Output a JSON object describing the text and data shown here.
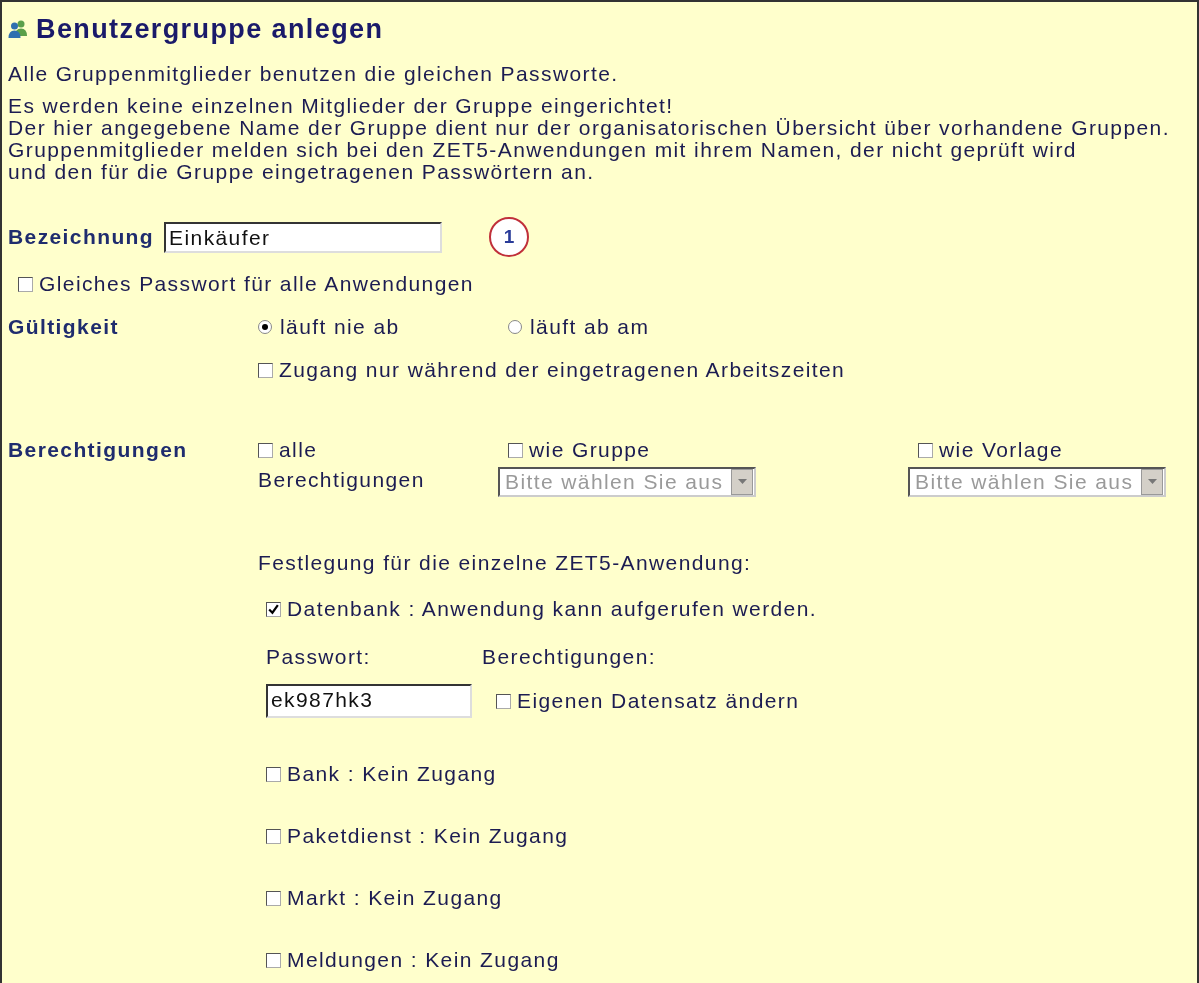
{
  "header": {
    "title": "Benutzergruppe anlegen"
  },
  "intro": "Alle Gruppenmitglieder benutzen die gleichen Passworte.",
  "notes": [
    "Es werden keine einzelnen Mitglieder der Gruppe eingerichtet!",
    "Der hier angegebene Name der Gruppe dient nur der organisatorischen Übersicht über vorhandene Gruppen.",
    "Gruppenmitglieder melden sich bei den ZET5-Anwendungen mit ihrem Namen, der nicht geprüft wird",
    "und den für die Gruppe eingetragenen Passwörtern an."
  ],
  "name_field": {
    "label": "Bezeichnung",
    "value": "Einkäufer",
    "callout": "1"
  },
  "same_password": {
    "label": "Gleiches Passwort für alle Anwendungen",
    "checked": false
  },
  "validity": {
    "label": "Gültigkeit",
    "options": [
      {
        "label": "läuft nie ab",
        "selected": true
      },
      {
        "label": "läuft ab am",
        "selected": false
      }
    ],
    "working_hours": {
      "label": "Zugang nur während der eingetragenen Arbeitszeiten",
      "checked": false
    }
  },
  "permissions": {
    "label": "Berechtigungen",
    "all": {
      "label": "alle",
      "sublabel": "Berechtigungen",
      "checked": false
    },
    "sources": [
      {
        "label": "wie Gruppe",
        "checked": false,
        "select": {
          "placeholder": "Bitte wählen Sie aus",
          "disabled": true
        }
      },
      {
        "label": "wie Vorlage",
        "checked": false,
        "select": {
          "placeholder": "Bitte wählen Sie aus",
          "disabled": true
        }
      }
    ]
  },
  "applications": {
    "heading": "Festlegung für die einzelne ZET5-Anwendung:",
    "items": [
      {
        "label": "Datenbank : Anwendung kann aufgerufen werden.",
        "checked": true,
        "password_label": "Passwort:",
        "password": "ek987hk3",
        "rights_label": "Berechtigungen:",
        "rights": [
          {
            "label": "Eigenen Datensatz ändern",
            "checked": false
          }
        ]
      },
      {
        "label": "Bank : Kein Zugang",
        "checked": false
      },
      {
        "label": "Paketdienst : Kein Zugang",
        "checked": false
      },
      {
        "label": "Markt : Kein Zugang",
        "checked": false
      },
      {
        "label": "Meldungen : Kein Zugang",
        "checked": false
      }
    ]
  }
}
